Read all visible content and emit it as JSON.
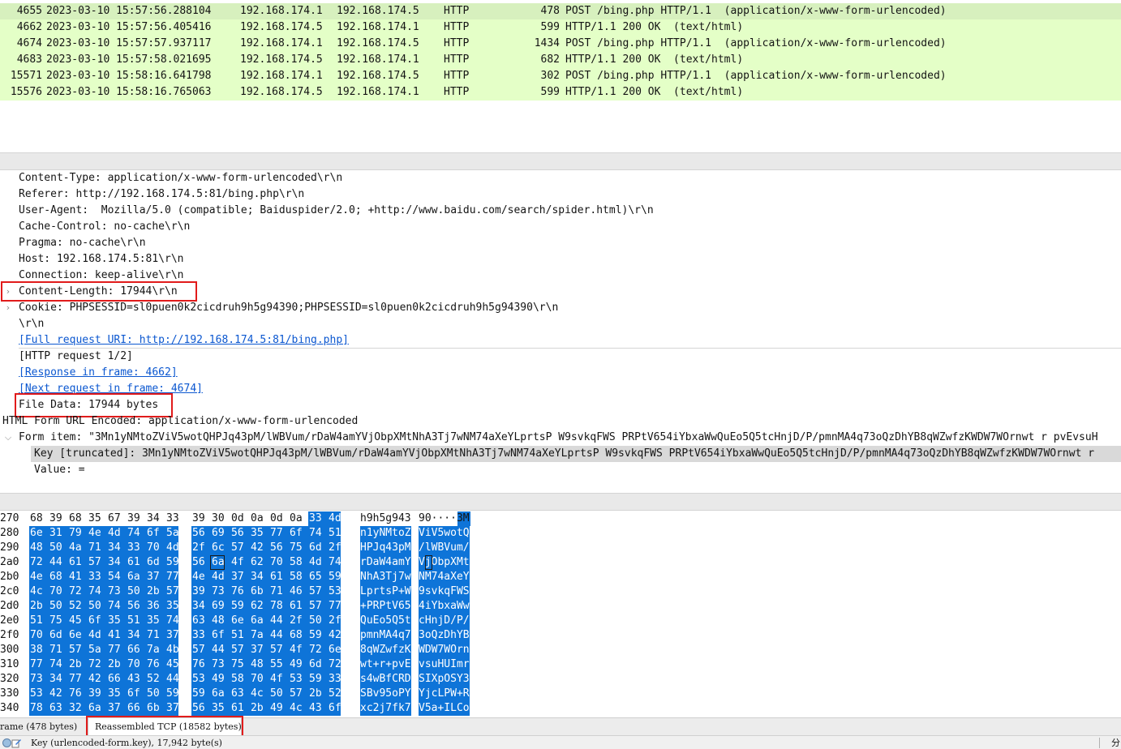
{
  "packets": [
    {
      "no": "4655",
      "time": "2023-03-10 15:57:56.288104",
      "src": "192.168.174.1",
      "dst": "192.168.174.5",
      "proto": "HTTP",
      "len": "478",
      "info": "POST /bing.php HTTP/1.1  (application/x-www-form-urlencoded)"
    },
    {
      "no": "4662",
      "time": "2023-03-10 15:57:56.405416",
      "src": "192.168.174.5",
      "dst": "192.168.174.1",
      "proto": "HTTP",
      "len": "599",
      "info": "HTTP/1.1 200 OK  (text/html)"
    },
    {
      "no": "4674",
      "time": "2023-03-10 15:57:57.937117",
      "src": "192.168.174.1",
      "dst": "192.168.174.5",
      "proto": "HTTP",
      "len": "1434",
      "info": "POST /bing.php HTTP/1.1  (application/x-www-form-urlencoded)"
    },
    {
      "no": "4683",
      "time": "2023-03-10 15:57:58.021695",
      "src": "192.168.174.5",
      "dst": "192.168.174.1",
      "proto": "HTTP",
      "len": "682",
      "info": "HTTP/1.1 200 OK  (text/html)"
    },
    {
      "no": "15571",
      "time": "2023-03-10 15:58:16.641798",
      "src": "192.168.174.1",
      "dst": "192.168.174.5",
      "proto": "HTTP",
      "len": "302",
      "info": "POST /bing.php HTTP/1.1  (application/x-www-form-urlencoded)"
    },
    {
      "no": "15576",
      "time": "2023-03-10 15:58:16.765063",
      "src": "192.168.174.5",
      "dst": "192.168.174.1",
      "proto": "HTTP",
      "len": "599",
      "info": "HTTP/1.1 200 OK  (text/html)"
    }
  ],
  "details": {
    "content_type": "Content-Type: application/x-www-form-urlencoded\\r\\n",
    "referer": "Referer: http://192.168.174.5:81/bing.php\\r\\n",
    "user_agent": "User-Agent:  Mozilla/5.0 (compatible; Baiduspider/2.0; +http://www.baidu.com/search/spider.html)\\r\\n",
    "cache_control": "Cache-Control: no-cache\\r\\n",
    "pragma": "Pragma: no-cache\\r\\n",
    "host": "Host: 192.168.174.5:81\\r\\n",
    "connection": "Connection: keep-alive\\r\\n",
    "content_length": "Content-Length: 17944\\r\\n",
    "cookie": "Cookie: PHPSESSID=sl0puen0k2cicdruh9h5g94390;PHPSESSID=sl0puen0k2cicdruh9h5g94390\\r\\n",
    "crlf": "\\r\\n",
    "full_uri": "[Full request URI: http://192.168.174.5:81/bing.php]",
    "request_num": "[HTTP request 1/2]",
    "response_in": "[Response in frame: 4662]",
    "next_request": "[Next request in frame: 4674]",
    "file_data": "File Data: 17944 bytes",
    "form_encoded": "HTML Form URL Encoded: application/x-www-form-urlencoded",
    "form_item": "Form item: \"3Mn1yNMtoZViV5wotQHPJq43pM/lWBVum/rDaW4amYVjObpXMtNhA3Tj7wNM74aXeYLprtsP W9svkqFWS PRPtV654iYbxaWwQuEo5Q5tcHnjD/P/pmnMA4q73oQzDhYB8qWZwfzKWDW7WOrnwt r pvEvsuH",
    "key": "Key [truncated]: 3Mn1yNMtoZViV5wotQHPJq43pM/lWBVum/rDaW4amYVjObpXMtNhA3Tj7wNM74aXeYLprtsP W9svkqFWS PRPtV654iYbxaWwQuEo5Q5tcHnjD/P/pmnMA4q73oQzDhYB8qWZwfzKWDW7WOrnwt r",
    "value": "Value: ="
  },
  "hex_rows": [
    {
      "off": "270",
      "bytes": [
        "68",
        "39",
        "68",
        "35",
        "67",
        "39",
        "34",
        "33",
        "39",
        "30",
        "0d",
        "0a",
        "0d",
        "0a",
        "33",
        "4d"
      ],
      "a1": "h9h5g943",
      "a2": "90····3M"
    },
    {
      "off": "280",
      "bytes": [
        "6e",
        "31",
        "79",
        "4e",
        "4d",
        "74",
        "6f",
        "5a",
        "56",
        "69",
        "56",
        "35",
        "77",
        "6f",
        "74",
        "51"
      ],
      "a1": "n1yNMtoZ",
      "a2": "ViV5wotQ"
    },
    {
      "off": "290",
      "bytes": [
        "48",
        "50",
        "4a",
        "71",
        "34",
        "33",
        "70",
        "4d",
        "2f",
        "6c",
        "57",
        "42",
        "56",
        "75",
        "6d",
        "2f"
      ],
      "a1": "HPJq43pM",
      "a2": "/lWBVum/"
    },
    {
      "off": "2a0",
      "bytes": [
        "72",
        "44",
        "61",
        "57",
        "34",
        "61",
        "6d",
        "59",
        "56",
        "6a",
        "4f",
        "62",
        "70",
        "58",
        "4d",
        "74"
      ],
      "a1": "rDaW4amY",
      "a2": "VjObpXMt"
    },
    {
      "off": "2b0",
      "bytes": [
        "4e",
        "68",
        "41",
        "33",
        "54",
        "6a",
        "37",
        "77",
        "4e",
        "4d",
        "37",
        "34",
        "61",
        "58",
        "65",
        "59"
      ],
      "a1": "NhA3Tj7w",
      "a2": "NM74aXeY"
    },
    {
      "off": "2c0",
      "bytes": [
        "4c",
        "70",
        "72",
        "74",
        "73",
        "50",
        "2b",
        "57",
        "39",
        "73",
        "76",
        "6b",
        "71",
        "46",
        "57",
        "53"
      ],
      "a1": "LprtsP+W",
      "a2": "9svkqFWS"
    },
    {
      "off": "2d0",
      "bytes": [
        "2b",
        "50",
        "52",
        "50",
        "74",
        "56",
        "36",
        "35",
        "34",
        "69",
        "59",
        "62",
        "78",
        "61",
        "57",
        "77"
      ],
      "a1": "+PRPtV65",
      "a2": "4iYbxaWw"
    },
    {
      "off": "2e0",
      "bytes": [
        "51",
        "75",
        "45",
        "6f",
        "35",
        "51",
        "35",
        "74",
        "63",
        "48",
        "6e",
        "6a",
        "44",
        "2f",
        "50",
        "2f"
      ],
      "a1": "QuEo5Q5t",
      "a2": "cHnjD/P/"
    },
    {
      "off": "2f0",
      "bytes": [
        "70",
        "6d",
        "6e",
        "4d",
        "41",
        "34",
        "71",
        "37",
        "33",
        "6f",
        "51",
        "7a",
        "44",
        "68",
        "59",
        "42"
      ],
      "a1": "pmnMA4q7",
      "a2": "3oQzDhYB"
    },
    {
      "off": "300",
      "bytes": [
        "38",
        "71",
        "57",
        "5a",
        "77",
        "66",
        "7a",
        "4b",
        "57",
        "44",
        "57",
        "37",
        "57",
        "4f",
        "72",
        "6e"
      ],
      "a1": "8qWZwfzK",
      "a2": "WDW7WOrn"
    },
    {
      "off": "310",
      "bytes": [
        "77",
        "74",
        "2b",
        "72",
        "2b",
        "70",
        "76",
        "45",
        "76",
        "73",
        "75",
        "48",
        "55",
        "49",
        "6d",
        "72"
      ],
      "a1": "wt+r+pvE",
      "a2": "vsuHUImr"
    },
    {
      "off": "320",
      "bytes": [
        "73",
        "34",
        "77",
        "42",
        "66",
        "43",
        "52",
        "44",
        "53",
        "49",
        "58",
        "70",
        "4f",
        "53",
        "59",
        "33"
      ],
      "a1": "s4wBfCRD",
      "a2": "SIXpOSY3"
    },
    {
      "off": "330",
      "bytes": [
        "53",
        "42",
        "76",
        "39",
        "35",
        "6f",
        "50",
        "59",
        "59",
        "6a",
        "63",
        "4c",
        "50",
        "57",
        "2b",
        "52"
      ],
      "a1": "SBv95oPY",
      "a2": "YjcLPW+R"
    },
    {
      "off": "340",
      "bytes": [
        "78",
        "63",
        "32",
        "6a",
        "37",
        "66",
        "6b",
        "37",
        "56",
        "35",
        "61",
        "2b",
        "49",
        "4c",
        "43",
        "6f"
      ],
      "a1": "xc2j7fk7",
      "a2": "V5a+ILCo"
    }
  ],
  "tabs": {
    "frame": "rame (478 bytes)",
    "reassembled": "Reassembled TCP (18582 bytes)"
  },
  "status": {
    "text": "Key (urlencoded-form.key), 17,942 byte(s)",
    "right": "分"
  },
  "colors": {
    "http_row": "#e4ffc7",
    "highlight": "#0e74d8",
    "annotation": "#e11b1b",
    "link": "#0b57d0"
  }
}
